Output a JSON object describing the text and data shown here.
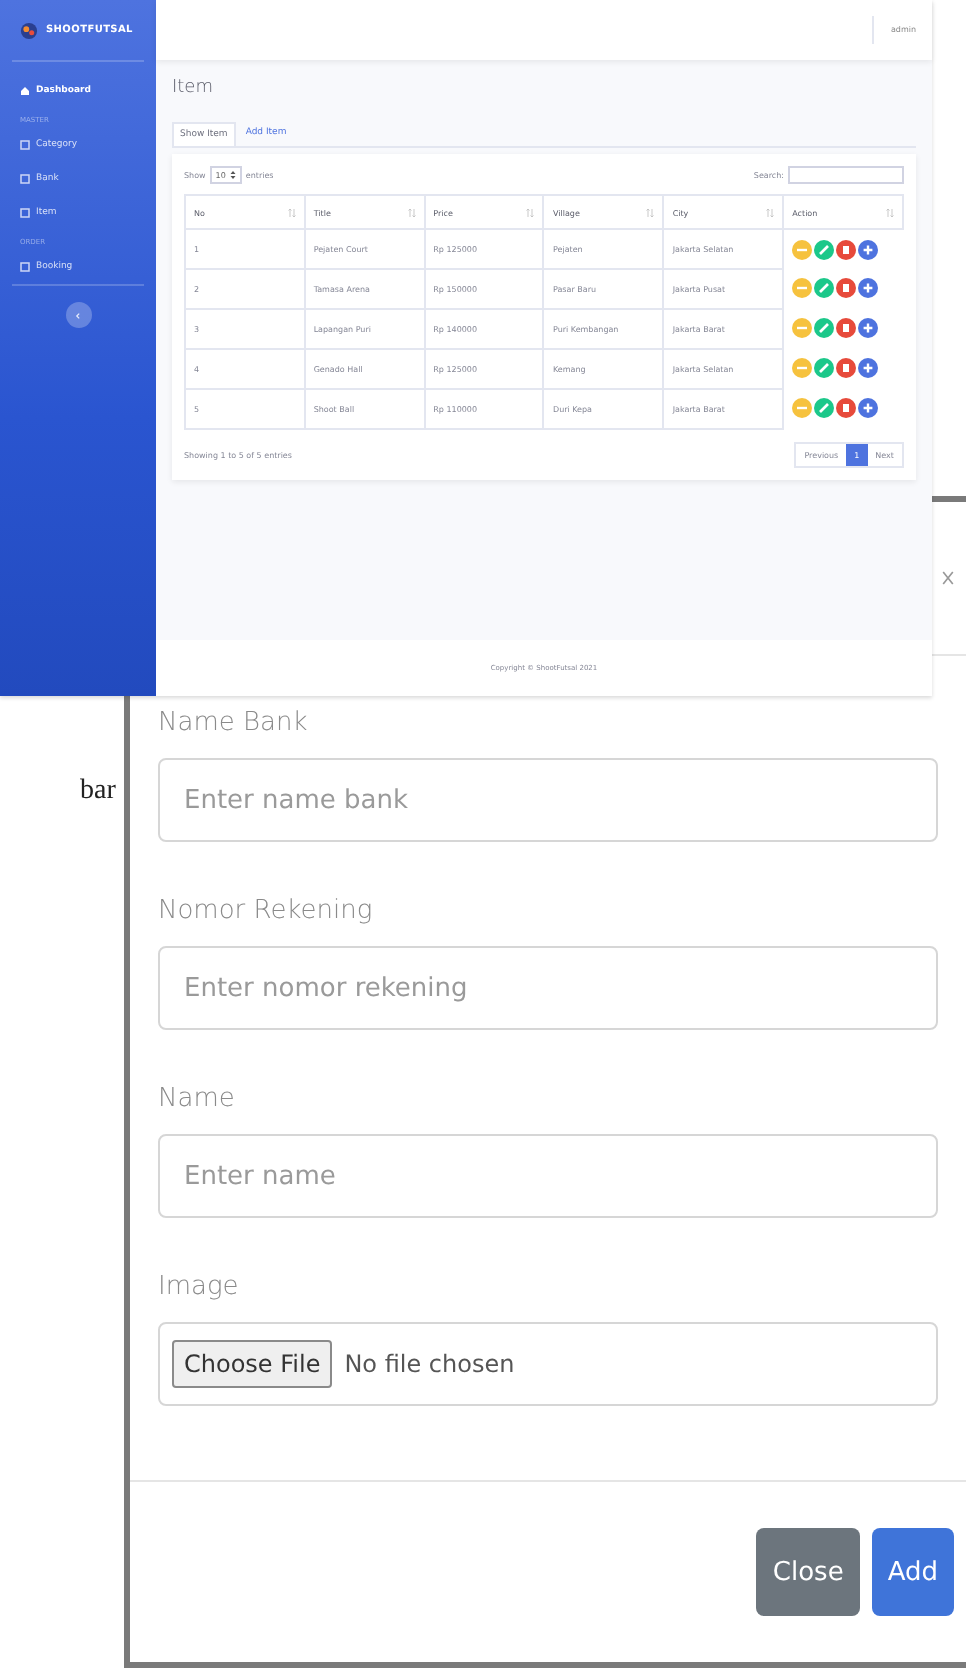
{
  "dashboard": {
    "brand": "SHOOTFUTSAL",
    "sidebar": {
      "items": [
        {
          "kind": "link",
          "label": "Dashboard",
          "selected": true
        },
        {
          "kind": "heading",
          "label": "MASTER"
        },
        {
          "kind": "link",
          "label": "Category",
          "selected": false
        },
        {
          "kind": "link",
          "label": "Bank",
          "selected": false
        },
        {
          "kind": "link",
          "label": "Item",
          "selected": false
        },
        {
          "kind": "heading",
          "label": "ORDER"
        },
        {
          "kind": "link",
          "label": "Booking",
          "selected": false
        }
      ]
    },
    "topbar": {
      "user": "admin"
    },
    "page_title": "Item",
    "tabs": [
      {
        "label": "Show Item",
        "selected": true
      },
      {
        "label": "Add Item",
        "selected": false
      }
    ],
    "table_controls": {
      "show_label": "Show",
      "length": "10",
      "entries_label": "entries",
      "search_label": "Search:"
    },
    "table": {
      "columns": [
        "No",
        "Title",
        "Price",
        "Village",
        "City",
        "Action"
      ],
      "rows": [
        {
          "cells": [
            "1",
            "Pejaten Court",
            "Rp 125000",
            "Pejaten",
            "Jakarta Selatan"
          ]
        },
        {
          "cells": [
            "2",
            "Tamasa Arena",
            "Rp 150000",
            "Pasar Baru",
            "Jakarta Pusat"
          ]
        },
        {
          "cells": [
            "3",
            "Lapangan Puri",
            "Rp 140000",
            "Puri Kembangan",
            "Jakarta Barat"
          ]
        },
        {
          "cells": [
            "4",
            "Genado Hall",
            "Rp 125000",
            "Kemang",
            "Jakarta Selatan"
          ]
        },
        {
          "cells": [
            "5",
            "Shoot Ball",
            "Rp 110000",
            "Duri Kepa",
            "Jakarta Barat"
          ]
        }
      ],
      "actions": [
        {
          "kind": "view",
          "color": "#f6c23e"
        },
        {
          "kind": "edit",
          "color": "#1cc88a"
        },
        {
          "kind": "delete",
          "color": "#e74a3b"
        },
        {
          "kind": "add",
          "color": "#4e73df"
        }
      ]
    },
    "info": "Showing 1 to 5 of 5 entries",
    "pagination": [
      {
        "label": "Previous",
        "selected": false
      },
      {
        "label": "1",
        "selected": true
      },
      {
        "label": "Next",
        "selected": false
      }
    ],
    "footer": "Copyright © ShootFutsal 2021"
  },
  "side_text": "bar",
  "modal": {
    "fields": [
      {
        "kind": "text",
        "label": "Name Bank",
        "placeholder": "Enter name bank"
      },
      {
        "kind": "text",
        "label": "Nomor Rekening",
        "placeholder": "Enter nomor rekening"
      },
      {
        "kind": "text",
        "label": "Name",
        "placeholder": "Enter name"
      },
      {
        "kind": "file",
        "label": "Image",
        "button": "Choose File",
        "value": "No file chosen"
      }
    ],
    "buttons": [
      {
        "kind": "secondary",
        "label": "Close"
      },
      {
        "kind": "primary",
        "label": "Add"
      }
    ]
  }
}
